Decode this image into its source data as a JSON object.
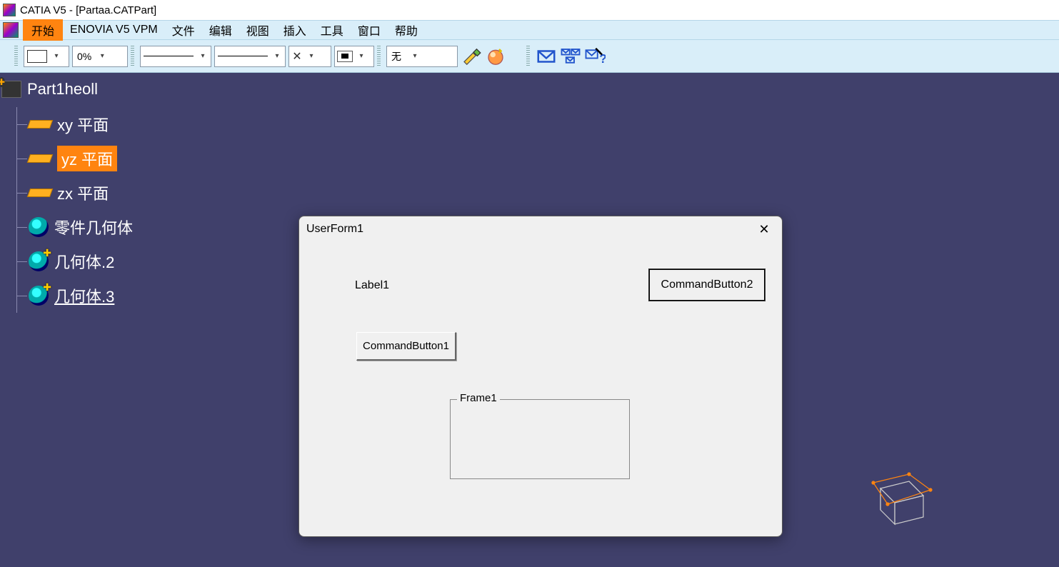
{
  "title_bar": {
    "text": "CATIA V5 - [Partaa.CATPart]"
  },
  "menu": {
    "start": "开始",
    "items": [
      "ENOVIA V5 VPM",
      "文件",
      "编辑",
      "视图",
      "插入",
      "工具",
      "窗口",
      "帮助"
    ]
  },
  "toolbar": {
    "opacity": "0%",
    "layer": "无"
  },
  "tree": {
    "root": "Part1heoll",
    "items": [
      {
        "label": "xy 平面",
        "type": "plane",
        "selected": false
      },
      {
        "label": "yz 平面",
        "type": "plane",
        "selected": true
      },
      {
        "label": "zx 平面",
        "type": "plane",
        "selected": false
      },
      {
        "label": "零件几何体",
        "type": "body",
        "plus": false
      },
      {
        "label": "几何体.2",
        "type": "body",
        "plus": true
      },
      {
        "label": "几何体.3",
        "type": "body",
        "plus": true,
        "underline": true
      }
    ]
  },
  "dialog": {
    "title": "UserForm1",
    "label1": "Label1",
    "button1": "CommandButton1",
    "button2": "CommandButton2",
    "frame1": "Frame1"
  }
}
